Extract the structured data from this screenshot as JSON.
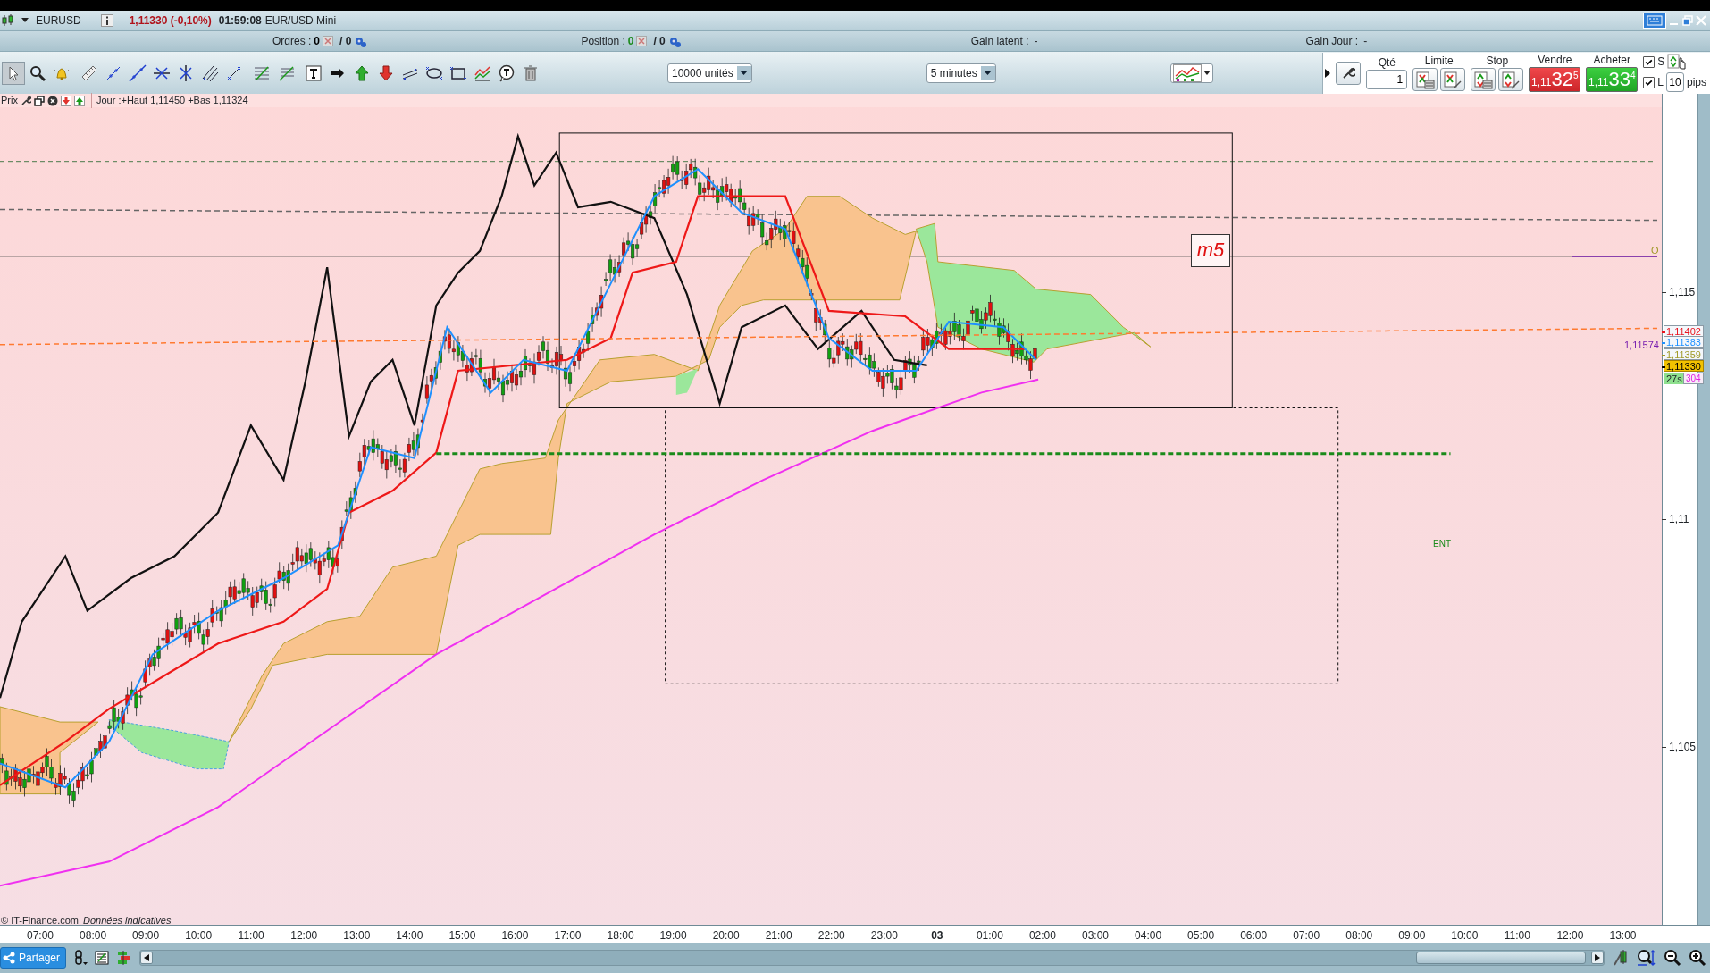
{
  "title_bar": {
    "symbol": "EURUSD",
    "quote": "1,11330 (-0,10%)",
    "time": "01:59:08",
    "instrument": "EUR/USD Mini"
  },
  "info_bar": {
    "orders": {
      "label": "Ordres :",
      "count": "0",
      "total": "/ 0"
    },
    "position": {
      "label": "Position :",
      "count": "0",
      "total": "/ 0"
    },
    "unrealized_gain": {
      "label": "Gain latent :",
      "value": "-"
    },
    "daily_gain": {
      "label": "Gain Jour :",
      "value": "-"
    }
  },
  "toolbar": {
    "tools": [
      {
        "kind": "pointer",
        "selected": true
      },
      {
        "kind": "zoom",
        "selected": false
      },
      {
        "kind": "alert",
        "selected": false
      },
      {
        "kind": "ruler",
        "selected": false
      },
      {
        "kind": "segment",
        "selected": false
      },
      {
        "kind": "line",
        "selected": false
      },
      {
        "kind": "hline",
        "selected": false
      },
      {
        "kind": "vline",
        "selected": false
      },
      {
        "kind": "channel",
        "selected": false
      },
      {
        "kind": "ray",
        "selected": false
      },
      {
        "kind": "fib",
        "selected": false
      },
      {
        "kind": "fib2",
        "selected": false
      },
      {
        "kind": "text",
        "selected": false
      },
      {
        "kind": "arrow",
        "selected": false
      },
      {
        "kind": "up",
        "selected": false
      },
      {
        "kind": "down",
        "selected": false
      },
      {
        "kind": "parallel",
        "selected": false
      },
      {
        "kind": "ellipse",
        "selected": false
      },
      {
        "kind": "rect",
        "selected": false
      },
      {
        "kind": "indicator",
        "selected": false
      },
      {
        "kind": "bubble",
        "selected": false
      },
      {
        "kind": "trash",
        "selected": false
      }
    ],
    "quantity": "10000 unités",
    "period": "5 minutes"
  },
  "order_panel": {
    "quantity_label": "Qté",
    "quantity": "1",
    "limit_label": "Limite",
    "stop_label": "Stop",
    "sell": {
      "label": "Vendre",
      "prefix": "1,11",
      "main": "32",
      "suffix": "5"
    },
    "buy": {
      "label": "Acheter",
      "prefix": "1,11",
      "main": "33",
      "suffix": "4"
    },
    "options": [
      {
        "label": "S",
        "checked": true
      },
      {
        "label": "L",
        "checked": true
      }
    ],
    "pips": "10",
    "pips_unit": "pips"
  },
  "chart": {
    "header_label": "Prix",
    "day_range": "Jour :+Haut 1,11450 +Bas 1,11324",
    "timeframe": "m5",
    "line_label": "1,11574",
    "target_marker": "O",
    "entry_label": "ENT",
    "copyright": "© IT-Finance.com",
    "disclaimer": "Données indicatives",
    "price_axis": [
      "1,115",
      "1,11",
      "1,105"
    ],
    "price_tags": [
      {
        "text": "1,11402",
        "color": "#e8141e",
        "kind": "indicator"
      },
      {
        "text": "1,11383",
        "color": "#1e90ff",
        "kind": "indicator"
      },
      {
        "text": "1,11359",
        "color": "#a09a28",
        "kind": "indicator"
      },
      {
        "text": "1,11330",
        "color": "#000000",
        "kind": "last"
      }
    ],
    "timer": "27s",
    "volume": "304",
    "time_axis": [
      {
        "text": "07:00",
        "bold": false
      },
      {
        "text": "08:00",
        "bold": false
      },
      {
        "text": "09:00",
        "bold": false
      },
      {
        "text": "10:00",
        "bold": false
      },
      {
        "text": "11:00",
        "bold": false
      },
      {
        "text": "12:00",
        "bold": false
      },
      {
        "text": "13:00",
        "bold": false
      },
      {
        "text": "14:00",
        "bold": false
      },
      {
        "text": "15:00",
        "bold": false
      },
      {
        "text": "16:00",
        "bold": false
      },
      {
        "text": "17:00",
        "bold": false
      },
      {
        "text": "18:00",
        "bold": false
      },
      {
        "text": "19:00",
        "bold": false
      },
      {
        "text": "20:00",
        "bold": false
      },
      {
        "text": "21:00",
        "bold": false
      },
      {
        "text": "22:00",
        "bold": false
      },
      {
        "text": "23:00",
        "bold": false
      },
      {
        "text": "03",
        "bold": true
      },
      {
        "text": "01:00",
        "bold": false
      },
      {
        "text": "02:00",
        "bold": false
      },
      {
        "text": "03:00",
        "bold": false
      },
      {
        "text": "04:00",
        "bold": false
      },
      {
        "text": "05:00",
        "bold": false
      },
      {
        "text": "06:00",
        "bold": false
      },
      {
        "text": "07:00",
        "bold": false
      },
      {
        "text": "08:00",
        "bold": false
      },
      {
        "text": "09:00",
        "bold": false
      },
      {
        "text": "10:00",
        "bold": false
      },
      {
        "text": "11:00",
        "bold": false
      },
      {
        "text": "12:00",
        "bold": false
      },
      {
        "text": "13:00",
        "bold": false
      }
    ]
  },
  "bottom_bar": {
    "share": "Partager"
  }
}
